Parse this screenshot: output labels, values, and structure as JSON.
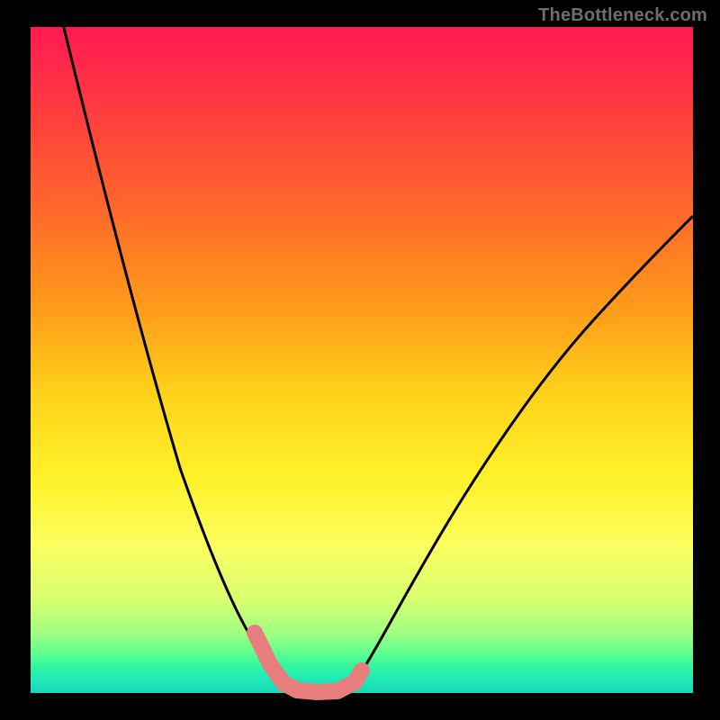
{
  "watermark": "TheBottleneck.com",
  "chart_data": {
    "type": "line",
    "title": "",
    "xlabel": "",
    "ylabel": "",
    "xlim": [
      0,
      100
    ],
    "ylim": [
      0,
      100
    ],
    "series": [
      {
        "name": "bottleneck-curve",
        "description": "V-shaped deviation curve over rainbow gradient background; minimum plateau near x≈38–46",
        "x": [
          5,
          10,
          15,
          20,
          25,
          30,
          33,
          36,
          38,
          40,
          42,
          44,
          46,
          50,
          55,
          60,
          65,
          70,
          75,
          80,
          85,
          90,
          95,
          100
        ],
        "values": [
          100,
          85,
          71,
          56,
          42,
          26,
          16,
          7,
          2,
          0,
          0,
          0,
          2,
          9,
          19,
          28,
          36,
          43,
          49,
          54,
          59,
          63,
          67,
          70
        ]
      },
      {
        "name": "highlight-segment",
        "description": "Thick pink highlight over the low region of the curve",
        "x": [
          33,
          36,
          38,
          40,
          42,
          44,
          46
        ],
        "values": [
          16,
          7,
          2,
          0,
          0,
          0,
          2
        ]
      }
    ],
    "bands": [
      {
        "name": "green-band",
        "y0": 0,
        "y1": 8,
        "color_desc": "green/cyan bottom band"
      },
      {
        "name": "yellow-band",
        "y0": 8,
        "y1": 50,
        "color_desc": "yellow mid"
      },
      {
        "name": "red-band",
        "y0": 50,
        "y1": 100,
        "color_desc": "orange to red top"
      }
    ]
  },
  "colors": {
    "curve": "#000000",
    "highlight": "#e77e7d",
    "frame": "#000000"
  }
}
